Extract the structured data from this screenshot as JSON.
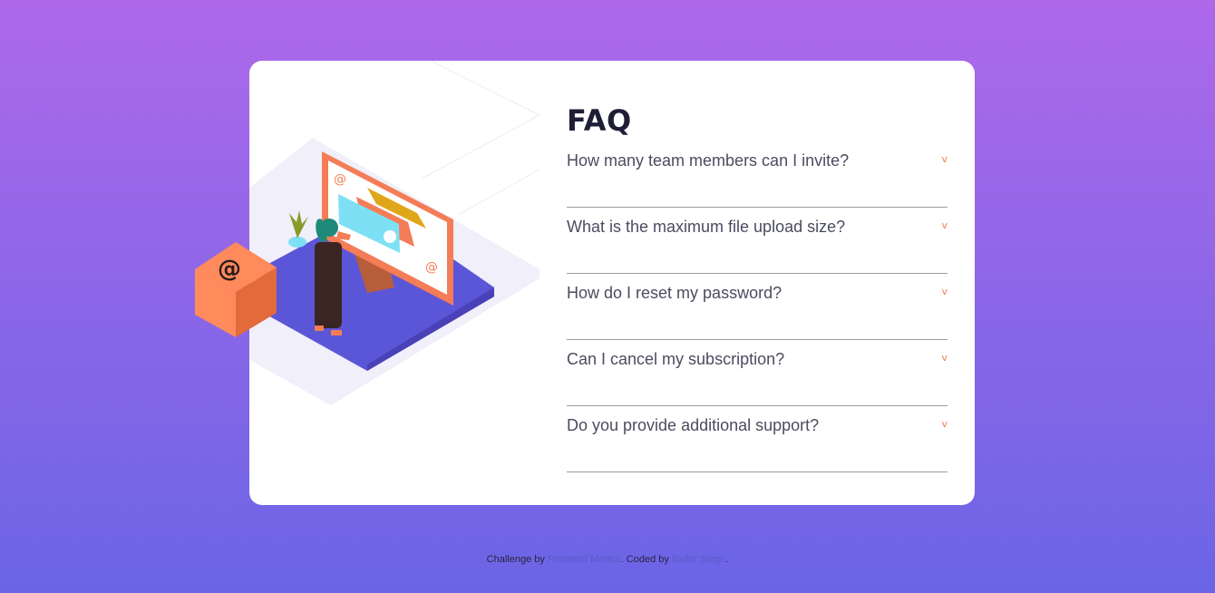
{
  "faq": {
    "title": "FAQ",
    "items": [
      {
        "question": "How many team members can I invite?",
        "icon": "chevron-down-icon"
      },
      {
        "question": "What is the maximum file upload size?",
        "icon": "chevron-down-icon"
      },
      {
        "question": "How do I reset my password?",
        "icon": "chevron-down-icon"
      },
      {
        "question": "Can I cancel my subscription?",
        "icon": "chevron-down-icon"
      },
      {
        "question": "Do you provide additional support?",
        "icon": "chevron-down-icon"
      }
    ],
    "arrow_glyph": "v"
  },
  "attribution": {
    "prefix": "Challenge by ",
    "link1": "Frontend Mentor",
    "middle": ". Coded by ",
    "link2": "Balbir Singh",
    "suffix": "."
  },
  "colors": {
    "background_top": "#ae68ea",
    "background_bottom": "#6a65e6",
    "accent": "#f47c57",
    "heading": "#1e1f36",
    "text": "#4b4c5f"
  },
  "illustration": {
    "box_symbol": "@",
    "screen_symbol": "@"
  }
}
